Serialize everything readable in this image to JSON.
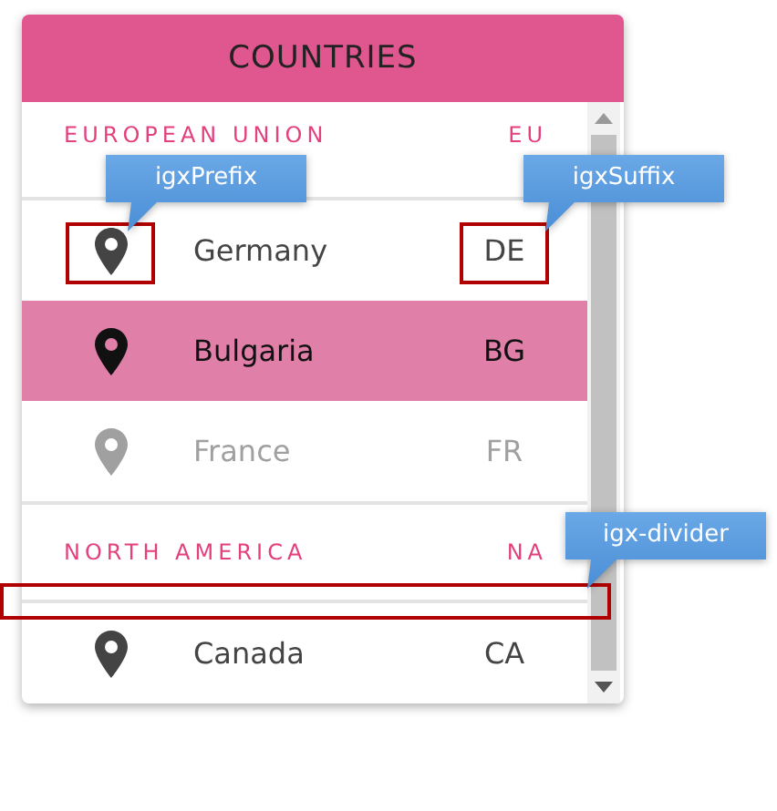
{
  "title": "COUNTRIES",
  "groups": [
    {
      "header": "EUROPEAN UNION",
      "code": "EU",
      "items": [
        {
          "name": "Germany",
          "code": "DE",
          "selected": false,
          "disabled": false
        },
        {
          "name": "Bulgaria",
          "code": "BG",
          "selected": true,
          "disabled": false
        },
        {
          "name": "France",
          "code": "FR",
          "selected": false,
          "disabled": true
        }
      ]
    },
    {
      "header": "NORTH AMERICA",
      "code": "NA",
      "items": [
        {
          "name": "Canada",
          "code": "CA",
          "selected": false,
          "disabled": false
        }
      ]
    }
  ],
  "callouts": [
    {
      "label": "igxPrefix"
    },
    {
      "label": "igxSuffix"
    },
    {
      "label": "igx-divider"
    }
  ]
}
